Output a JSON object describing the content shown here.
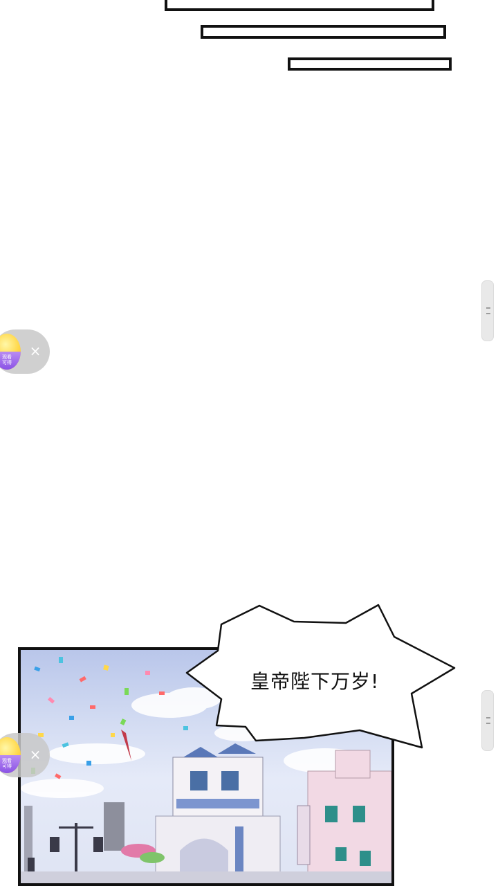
{
  "top_captions": [
    "",
    "",
    ""
  ],
  "speech_bubble": {
    "text": "皇帝陛下万岁!"
  },
  "reward_widget": {
    "coin_label": "观看\n可得",
    "close_symbol": "×",
    "icon": "coin-reward-icon"
  },
  "scroll_handle": {
    "icon": "drag-grip-icon"
  },
  "colors": {
    "panel_border": "#111111",
    "sky": "#c9d3f0",
    "building_pink": "#f2d9e4",
    "building_white": "#f4f2f6"
  }
}
